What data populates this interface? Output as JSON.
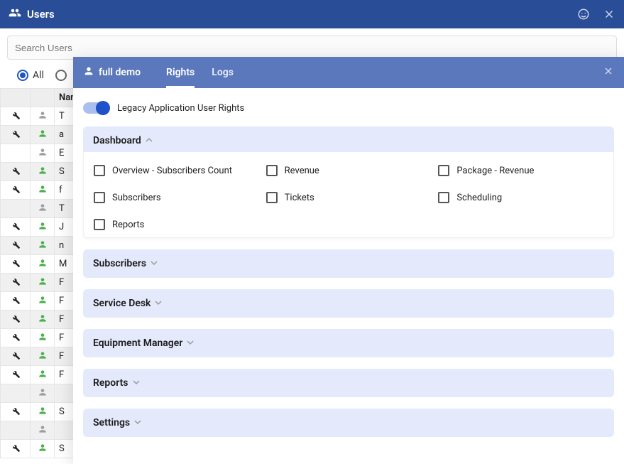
{
  "titlebar": {
    "title": "Users"
  },
  "bg": {
    "search_placeholder": "Search Users",
    "filter_all": "All",
    "name_col": "Name",
    "rows": [
      {
        "wrench": true,
        "online": false,
        "name": "T"
      },
      {
        "wrench": true,
        "online": true,
        "name": "a"
      },
      {
        "wrench": false,
        "online": false,
        "name": "E"
      },
      {
        "wrench": true,
        "online": true,
        "name": "S"
      },
      {
        "wrench": true,
        "online": true,
        "name": "f"
      },
      {
        "wrench": false,
        "online": false,
        "name": "T"
      },
      {
        "wrench": true,
        "online": true,
        "name": "J"
      },
      {
        "wrench": true,
        "online": true,
        "name": "n"
      },
      {
        "wrench": true,
        "online": true,
        "name": "M"
      },
      {
        "wrench": true,
        "online": true,
        "name": "F"
      },
      {
        "wrench": true,
        "online": true,
        "name": "F"
      },
      {
        "wrench": true,
        "online": true,
        "name": "F"
      },
      {
        "wrench": true,
        "online": true,
        "name": "F"
      },
      {
        "wrench": true,
        "online": true,
        "name": "F"
      },
      {
        "wrench": true,
        "online": true,
        "name": "F"
      },
      {
        "wrench": false,
        "online": false,
        "name": ""
      },
      {
        "wrench": true,
        "online": true,
        "name": "S"
      },
      {
        "wrench": false,
        "online": false,
        "name": ""
      },
      {
        "wrench": true,
        "online": true,
        "name": "S"
      }
    ]
  },
  "panel": {
    "user_name": "full demo",
    "tab_rights": "Rights",
    "tab_logs": "Logs",
    "legacy_label": "Legacy Application User Rights",
    "sections": {
      "dashboard": {
        "title": "Dashboard",
        "items": [
          "Overview - Subscribers Count",
          "Revenue",
          "Package - Revenue",
          "Subscribers",
          "Tickets",
          "Scheduling",
          "Reports"
        ]
      },
      "subscribers": {
        "title": "Subscribers"
      },
      "service_desk": {
        "title": "Service Desk"
      },
      "equipment_manager": {
        "title": "Equipment Manager"
      },
      "reports": {
        "title": "Reports"
      },
      "settings": {
        "title": "Settings"
      }
    }
  }
}
